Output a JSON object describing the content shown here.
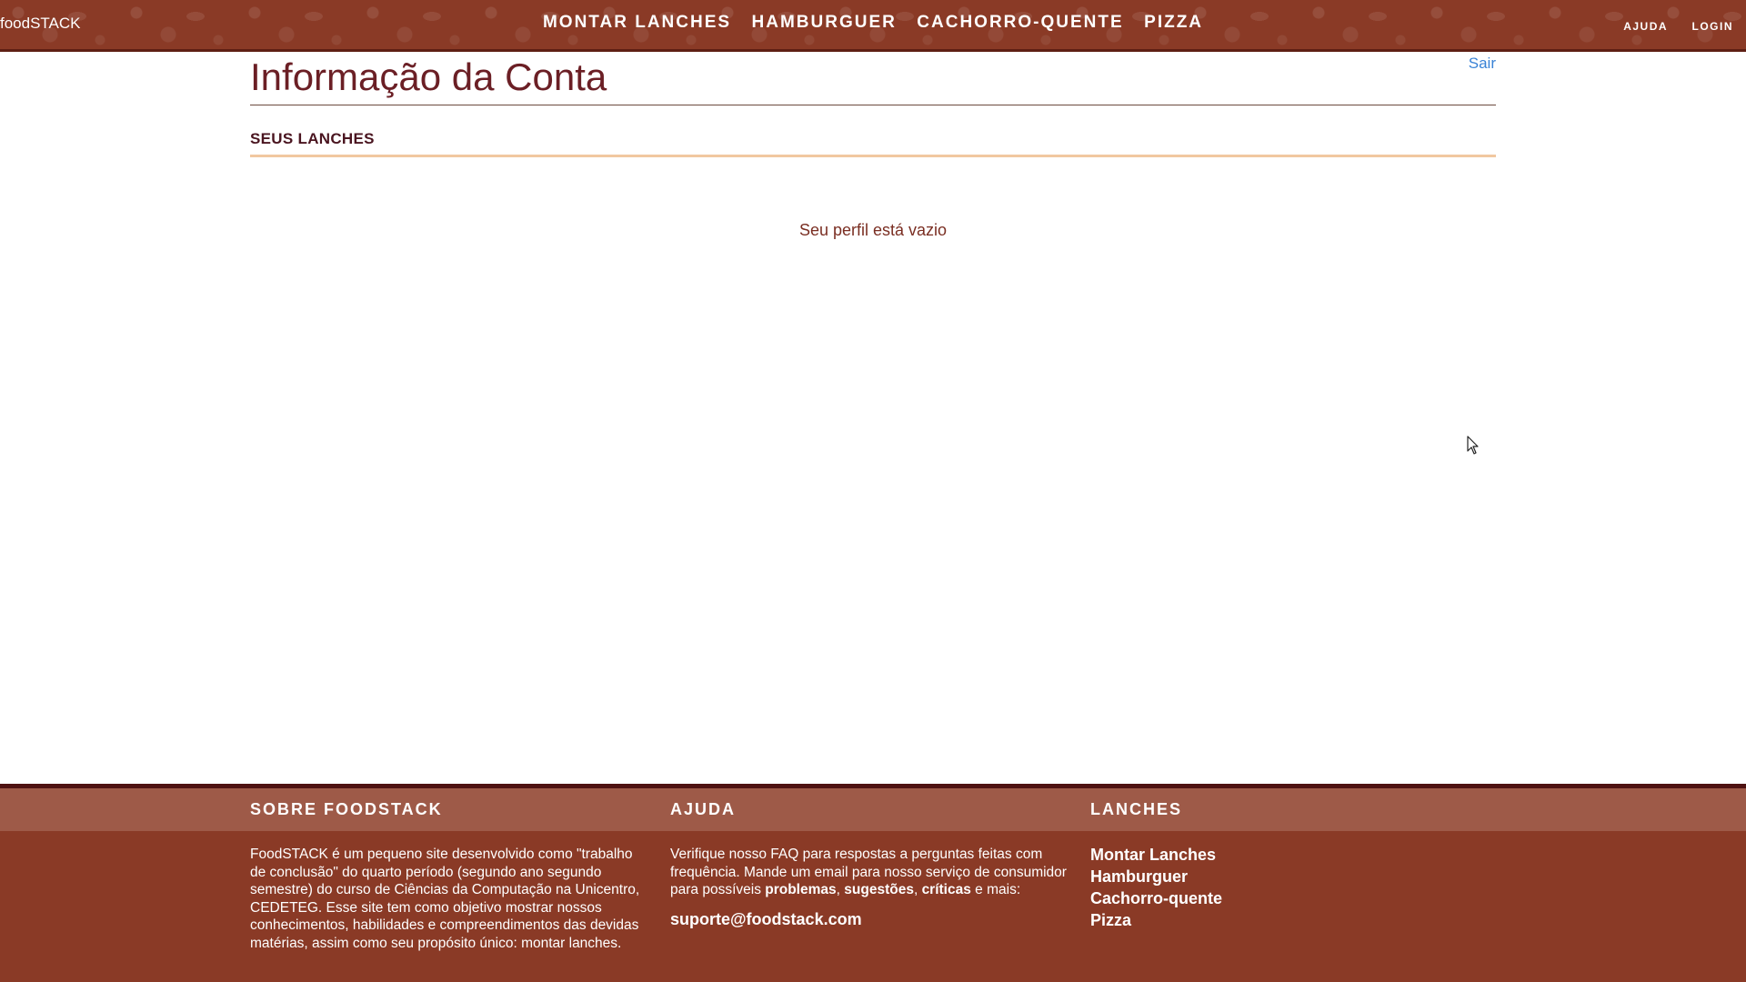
{
  "header": {
    "logo": "foodSTACK",
    "nav": [
      "MONTAR LANCHES",
      "HAMBURGUER",
      "CACHORRO-QUENTE",
      "PIZZA"
    ],
    "aux": [
      "AJUDA",
      "LOGIN"
    ]
  },
  "main": {
    "title": "Informação da Conta",
    "logout": "Sair",
    "section_title": "SEUS LANCHES",
    "empty_message": "Seu perfil está vazio"
  },
  "footer": {
    "about": {
      "title": "SOBRE FOODSTACK",
      "text": "FoodSTACK é um pequeno site desenvolvido como \"trabalho de conclusão\" do quarto período (segundo ano segundo semestre) do curso de Ciências da Computação na Unicentro, CEDETEG. Esse site tem como objetivo mostrar nossos conhecimentos, habilidades e compreendimentos das devidas matérias, assim como seu propósito único: montar lanches."
    },
    "help": {
      "title": "AJUDA",
      "text_before": "Verifique nosso FAQ para respostas a perguntas feitas com frequência. Mande um email para nosso serviço de consumidor para possíveis ",
      "bold1": "problemas",
      "sep1": ", ",
      "bold2": "sugestões",
      "sep2": ", ",
      "bold3": "críticas",
      "text_after": " e mais:",
      "email": "suporte@foodstack.com"
    },
    "snacks": {
      "title": "LANCHES",
      "links": [
        "Montar Lanches",
        "Hamburguer",
        "Cachorro-quente",
        "Pizza"
      ]
    }
  },
  "colors": {
    "header_bg": "#8a3a26",
    "title": "#6b1f25",
    "link": "#3a83d6",
    "footer_bar": "#9e5a48",
    "section_rule": "#f1c8a0"
  }
}
